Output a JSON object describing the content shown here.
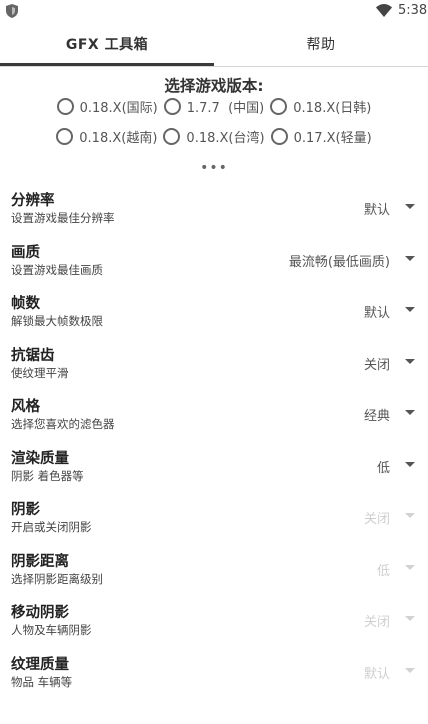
{
  "status_bar": {
    "time": "5:38",
    "icons": [
      "shield-icon",
      "wifi-icon"
    ]
  },
  "tabs": [
    {
      "label": "GFX 工具箱",
      "active": true
    },
    {
      "label": "帮助",
      "active": false
    }
  ],
  "version": {
    "title": "选择游戏版本:",
    "options": [
      "0.18.X(国际)",
      "1.7.7  (中国)",
      "0.18.X(日韩)",
      "0.18.X(越南)",
      "0.18.X(台湾)",
      "0.17.X(轻量)"
    ]
  },
  "more_indicator": "•••",
  "settings": [
    {
      "label": "分辨率",
      "desc": "设置游戏最佳分辨率",
      "value": "默认",
      "enabled": true
    },
    {
      "label": "画质",
      "desc": "设置游戏最佳画质",
      "value": "最流畅(最低画质)",
      "enabled": true
    },
    {
      "label": "帧数",
      "desc": "解锁最大帧数极限",
      "value": "默认",
      "enabled": true
    },
    {
      "label": "抗锯齿",
      "desc": "使纹理平滑",
      "value": "关闭",
      "enabled": true
    },
    {
      "label": "风格",
      "desc": "选择您喜欢的滤色器",
      "value": "经典",
      "enabled": true
    },
    {
      "label": "渲染质量",
      "desc": "阴影 着色器等",
      "value": "低",
      "enabled": true
    },
    {
      "label": "阴影",
      "desc": "开启或关闭阴影",
      "value": "关闭",
      "enabled": false
    },
    {
      "label": "阴影距离",
      "desc": "选择阴影距离级别",
      "value": "低",
      "enabled": false
    },
    {
      "label": "移动阴影",
      "desc": "人物及车辆阴影",
      "value": "关闭",
      "enabled": false
    },
    {
      "label": "纹理质量",
      "desc": "物品 车辆等",
      "value": "默认",
      "enabled": false
    }
  ]
}
